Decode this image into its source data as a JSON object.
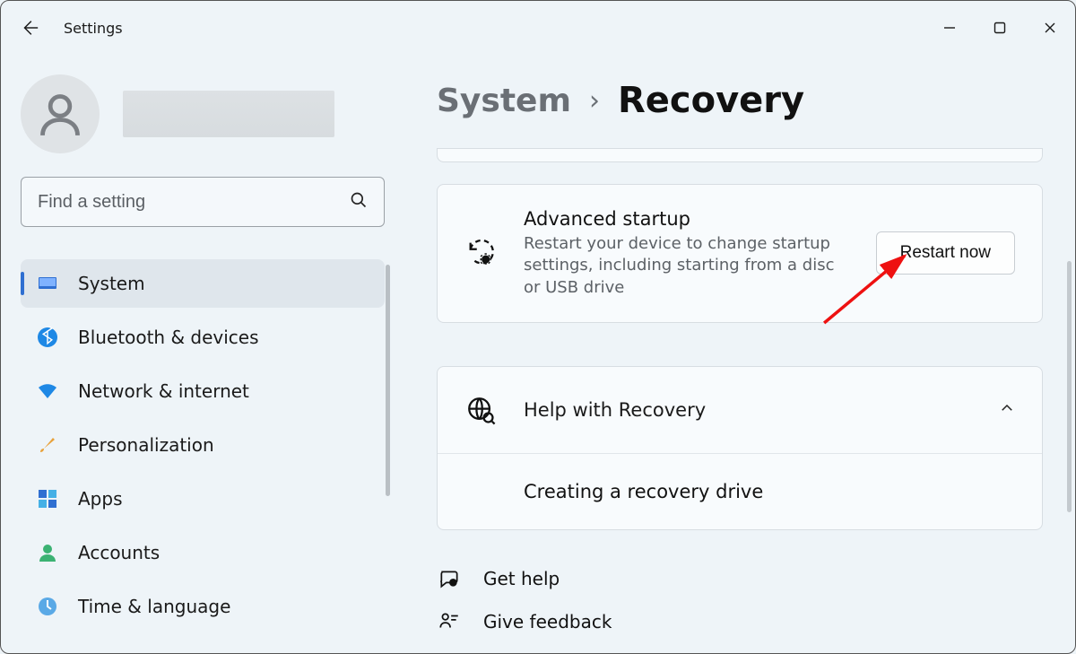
{
  "window": {
    "app_title": "Settings"
  },
  "search": {
    "placeholder": "Find a setting"
  },
  "sidebar": {
    "items": [
      {
        "label": "System"
      },
      {
        "label": "Bluetooth & devices"
      },
      {
        "label": "Network & internet"
      },
      {
        "label": "Personalization"
      },
      {
        "label": "Apps"
      },
      {
        "label": "Accounts"
      },
      {
        "label": "Time & language"
      }
    ]
  },
  "breadcrumb": {
    "parent": "System",
    "current": "Recovery"
  },
  "advanced": {
    "title": "Advanced startup",
    "desc": "Restart your device to change startup settings, including starting from a disc or USB drive",
    "button": "Restart now"
  },
  "help": {
    "title": "Help with Recovery",
    "items": [
      {
        "label": "Creating a recovery drive"
      }
    ]
  },
  "footer": {
    "get_help": "Get help",
    "give_feedback": "Give feedback"
  }
}
